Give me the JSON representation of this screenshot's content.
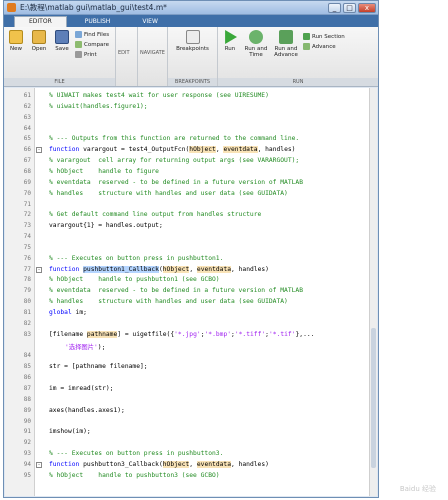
{
  "window": {
    "title": "E:\\教程\\matlab gui\\matlab_gui\\test4.m*",
    "minimize": "_",
    "maximize": "□",
    "close": "x"
  },
  "tabs": [
    "EDITOR",
    "PUBLISH",
    "VIEW"
  ],
  "ribbon": {
    "file": {
      "label": "FILE",
      "new": "New",
      "open": "Open",
      "save": "Save",
      "find_files": "Find Files",
      "compare": "Compare",
      "print": "Print"
    },
    "edit": {
      "label": "EDIT"
    },
    "navigate": {
      "label": "NAVIGATE"
    },
    "breakpoints": {
      "label": "BREAKPOINTS",
      "button": "Breakpoints"
    },
    "run": {
      "label": "RUN",
      "run": "Run",
      "run_and_time": "Run and Time",
      "run_and_advance": "Run and Advance",
      "run_section": "Run Section",
      "advance": "Advance"
    }
  },
  "code_lines": [
    {
      "n": "61",
      "fold": "",
      "text": "% UIWAIT makes test4 wait for user response (see UIRESUME)",
      "cls": "cmt"
    },
    {
      "n": "62",
      "fold": "",
      "text": "% uiwait(handles.figure1);",
      "cls": "cmt"
    },
    {
      "n": "63",
      "fold": "",
      "text": "",
      "cls": ""
    },
    {
      "n": "64",
      "fold": "",
      "text": "",
      "cls": ""
    },
    {
      "n": "65",
      "fold": "",
      "text": "% --- Outputs from this function are returned to the command line.",
      "cls": "cmt"
    },
    {
      "n": "66",
      "fold": "-",
      "text": "",
      "cls": "fn66"
    },
    {
      "n": "67",
      "fold": "",
      "text": "% varargout  cell array for returning output args (see VARARGOUT);",
      "cls": "cmt"
    },
    {
      "n": "68",
      "fold": "",
      "text": "% hObject    handle to figure",
      "cls": "cmt"
    },
    {
      "n": "69",
      "fold": "",
      "text": "% eventdata  reserved - to be defined in a future version of MATLAB",
      "cls": "cmt"
    },
    {
      "n": "70",
      "fold": "",
      "text": "% handles    structure with handles and user data (see GUIDATA)",
      "cls": "cmt"
    },
    {
      "n": "71",
      "fold": "",
      "text": "",
      "cls": ""
    },
    {
      "n": "72",
      "fold": "",
      "text": "% Get default command line output from handles structure",
      "cls": "cmt"
    },
    {
      "n": "73",
      "fold": "",
      "text": "varargout{1} = handles.output;",
      "cls": ""
    },
    {
      "n": "74",
      "fold": "",
      "text": "",
      "cls": ""
    },
    {
      "n": "75",
      "fold": "",
      "text": "",
      "cls": ""
    },
    {
      "n": "76",
      "fold": "",
      "text": "% --- Executes on button press in pushbutton1.",
      "cls": "cmt"
    },
    {
      "n": "77",
      "fold": "-",
      "text": "",
      "cls": "fn77"
    },
    {
      "n": "78",
      "fold": "",
      "text": "% hObject    handle to pushbutton1 (see GCBO)",
      "cls": "cmt"
    },
    {
      "n": "79",
      "fold": "",
      "text": "% eventdata  reserved - to be defined in a future version of MATLAB",
      "cls": "cmt"
    },
    {
      "n": "80",
      "fold": "",
      "text": "% handles    structure with handles and user data (see GUIDATA)",
      "cls": "cmt"
    },
    {
      "n": "81",
      "fold": "",
      "text": "",
      "cls": "g81"
    },
    {
      "n": "82",
      "fold": "",
      "text": "",
      "cls": ""
    },
    {
      "n": "83",
      "fold": "",
      "text": "",
      "cls": "l83"
    },
    {
      "n": "",
      "fold": "",
      "text": "",
      "cls": "l83b"
    },
    {
      "n": "84",
      "fold": "",
      "text": "",
      "cls": ""
    },
    {
      "n": "85",
      "fold": "",
      "text": "str = [pathname filename];",
      "cls": ""
    },
    {
      "n": "86",
      "fold": "",
      "text": "",
      "cls": ""
    },
    {
      "n": "87",
      "fold": "",
      "text": "im = imread(str);",
      "cls": ""
    },
    {
      "n": "88",
      "fold": "",
      "text": "",
      "cls": ""
    },
    {
      "n": "89",
      "fold": "",
      "text": "axes(handles.axes1);",
      "cls": ""
    },
    {
      "n": "90",
      "fold": "",
      "text": "",
      "cls": ""
    },
    {
      "n": "91",
      "fold": "",
      "text": "imshow(im);",
      "cls": ""
    },
    {
      "n": "92",
      "fold": "",
      "text": "",
      "cls": ""
    },
    {
      "n": "93",
      "fold": "",
      "text": "% --- Executes on button press in pushbutton3.",
      "cls": "cmt"
    },
    {
      "n": "94",
      "fold": "-",
      "text": "",
      "cls": "fn94"
    },
    {
      "n": "95",
      "fold": "",
      "text": "% hObject    handle to pushbutton3 (see GCBO)",
      "cls": "cmt"
    }
  ],
  "fn66": {
    "kw": "function",
    "a": " varargout = test4_OutputFcn(",
    "p1": "hObject",
    "c1": ", ",
    "p2": "eventdata",
    "c2": ", handles)"
  },
  "fn77": {
    "kw": "function",
    "sp": " ",
    "name": "pushbutton1_Callback",
    "o": "(",
    "p1": "hObject",
    "c1": ", ",
    "p2": "eventdata",
    "c2": ", handles)"
  },
  "g81": {
    "kw": "global",
    "rest": " im;"
  },
  "l83": {
    "a": "[filename ",
    "p": "pathname",
    "b": "] = uigetfile({",
    "s1": "'*.jpg'",
    "c1": ";",
    "s2": "'*.bmp'",
    "c2": ";",
    "s3": "'*.tiff'",
    "c3": ";",
    "s4": "'*.tif'",
    "d": "},..."
  },
  "l83b": {
    "s": "'选择图片'",
    "e": ");"
  },
  "fn94": {
    "kw": "function",
    "a": " pushbutton3_Callback(",
    "p1": "hObject",
    "c1": ", ",
    "p2": "eventdata",
    "c2": ", handles)"
  },
  "colors": {
    "comment": "#228b22",
    "keyword": "#0000ff",
    "string": "#a020f0",
    "titlebar": "#9fbde3",
    "tabstrip": "#3f6fa8"
  },
  "watermark": "Baidu 经验"
}
